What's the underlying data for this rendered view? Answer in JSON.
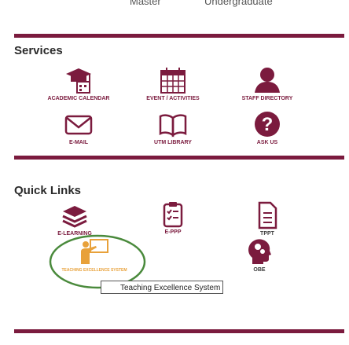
{
  "header": {
    "left_label": "Master",
    "right_label": "Undergraduate"
  },
  "colors": {
    "brand": "#7b1b3e",
    "highlight_circle": "#4a8a3c"
  },
  "services": {
    "title": "Services",
    "items": [
      {
        "label": "ACADEMIC CALENDAR",
        "icon": "graduation-cap-calendar-icon"
      },
      {
        "label": "EVENT / ACTIVITIES",
        "icon": "calendar-grid-icon"
      },
      {
        "label": "STAFF DIRECTORY",
        "icon": "person-icon"
      },
      {
        "label": "E-MAIL",
        "icon": "envelope-icon"
      },
      {
        "label": "UTM LIBRARY",
        "icon": "book-icon"
      },
      {
        "label": "ASK US",
        "icon": "question-icon"
      }
    ]
  },
  "quick_links": {
    "title": "Quick Links",
    "items": [
      {
        "label": "E-LEARNING",
        "icon": "stacked-layers-icon"
      },
      {
        "label": "E-PPP",
        "icon": "checklist-icon"
      },
      {
        "label": "TPPT",
        "icon": "document-list-icon"
      },
      {
        "label": "TEACHING EXCELLENCE SYSTEM",
        "icon": "teacher-board-icon"
      },
      {
        "label": "OBE",
        "icon": "head-gears-icon"
      }
    ]
  },
  "tooltip": {
    "text": "Teaching Excellence System"
  }
}
